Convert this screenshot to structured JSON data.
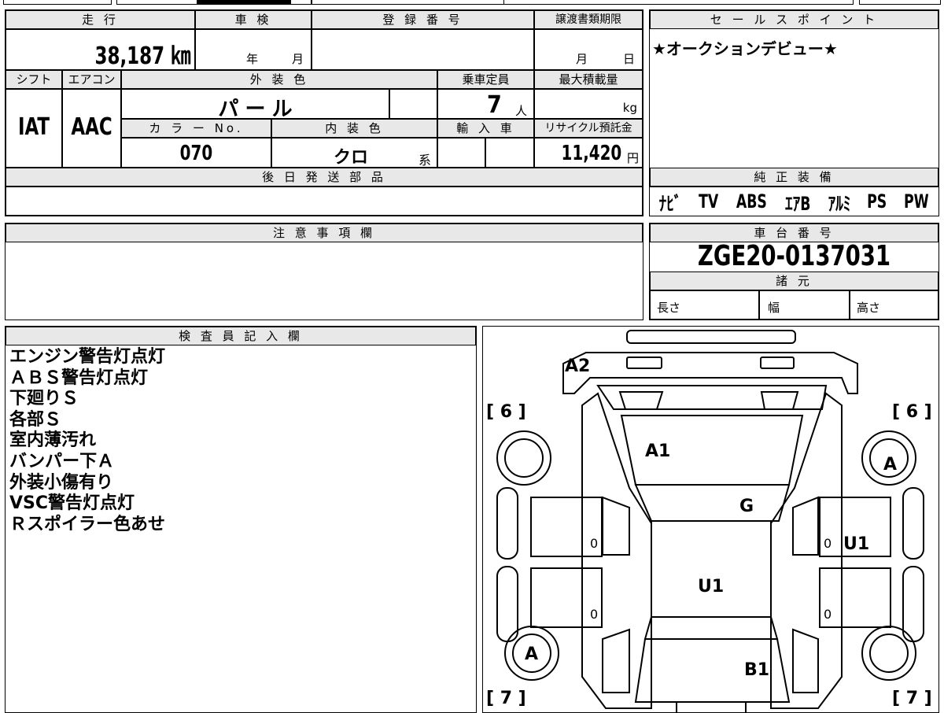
{
  "header": {
    "mileage_label": "走 行",
    "mileage_value": "38,187 ㎞",
    "shaken_label": "車 検",
    "shaken_year_unit": "年",
    "shaken_month_unit": "月",
    "registration_label": "登 録 番 号",
    "transfer_label": "譲渡書類期限",
    "transfer_month_unit": "月",
    "transfer_day_unit": "日"
  },
  "specs": {
    "shift_label": "シフト",
    "shift_value": "IAT",
    "aircon_label": "エアコン",
    "aircon_value": "AAC",
    "exterior_color_label": "外 装 色",
    "exterior_color_value": "パ ー ル",
    "color_no_label": "カ ラ ー No.",
    "color_no_value": "070",
    "interior_color_label": "内 装 色",
    "interior_color_value": "クロ",
    "interior_color_suffix": "系",
    "capacity_label": "乗車定員",
    "capacity_value": "7",
    "capacity_unit": "人",
    "max_load_label": "最大積載量",
    "max_load_unit": "kg",
    "import_label": "輸 入 車",
    "recycle_label": "リサイクル預託金",
    "recycle_value": "11,420",
    "recycle_unit": "円"
  },
  "later_parts": {
    "label": "後 日 発 送 部 品"
  },
  "sales_point": {
    "label": "セ ー ル ス ポ イ ン ト",
    "text": "★オークションデビュー★"
  },
  "genuine_equipment": {
    "label": "純 正 装 備",
    "items": [
      "ﾅﾋﾞ",
      "TV",
      "ABS",
      "ｴｱB",
      "ｱﾙﾐ",
      "PS",
      "PW"
    ]
  },
  "caution": {
    "label": "注 意 事 項 欄"
  },
  "chassis": {
    "label": "車 台 番 号",
    "number": "ZGE20-0137031"
  },
  "dimensions": {
    "label": "諸 元",
    "length_label": "長さ",
    "width_label": "幅",
    "height_label": "高さ"
  },
  "inspector": {
    "label": "検 査 員 記 入 欄",
    "notes": [
      "エンジン警告灯点灯",
      "ＡＢＳ警告灯点灯",
      "下廻りＳ",
      "各部Ｓ",
      "室内薄汚れ",
      "バンパー下Ａ",
      "外装小傷有り",
      "VSC警告灯点灯",
      "Ｒスポイラー色あせ"
    ]
  },
  "diagram": {
    "marks": {
      "a2": "A2",
      "a1": "A1",
      "g": "G",
      "u1_roof": "U1",
      "u1_right": "U1",
      "b1": "B1",
      "tire_a_front_right": "A",
      "tire_a_rear_left": "A",
      "zero": "0",
      "count_front_left": "[ 6 ]",
      "count_front_right": "[ 6 ]",
      "count_rear_left": "[ 7 ]",
      "count_rear_right": "[ 7 ]"
    }
  }
}
